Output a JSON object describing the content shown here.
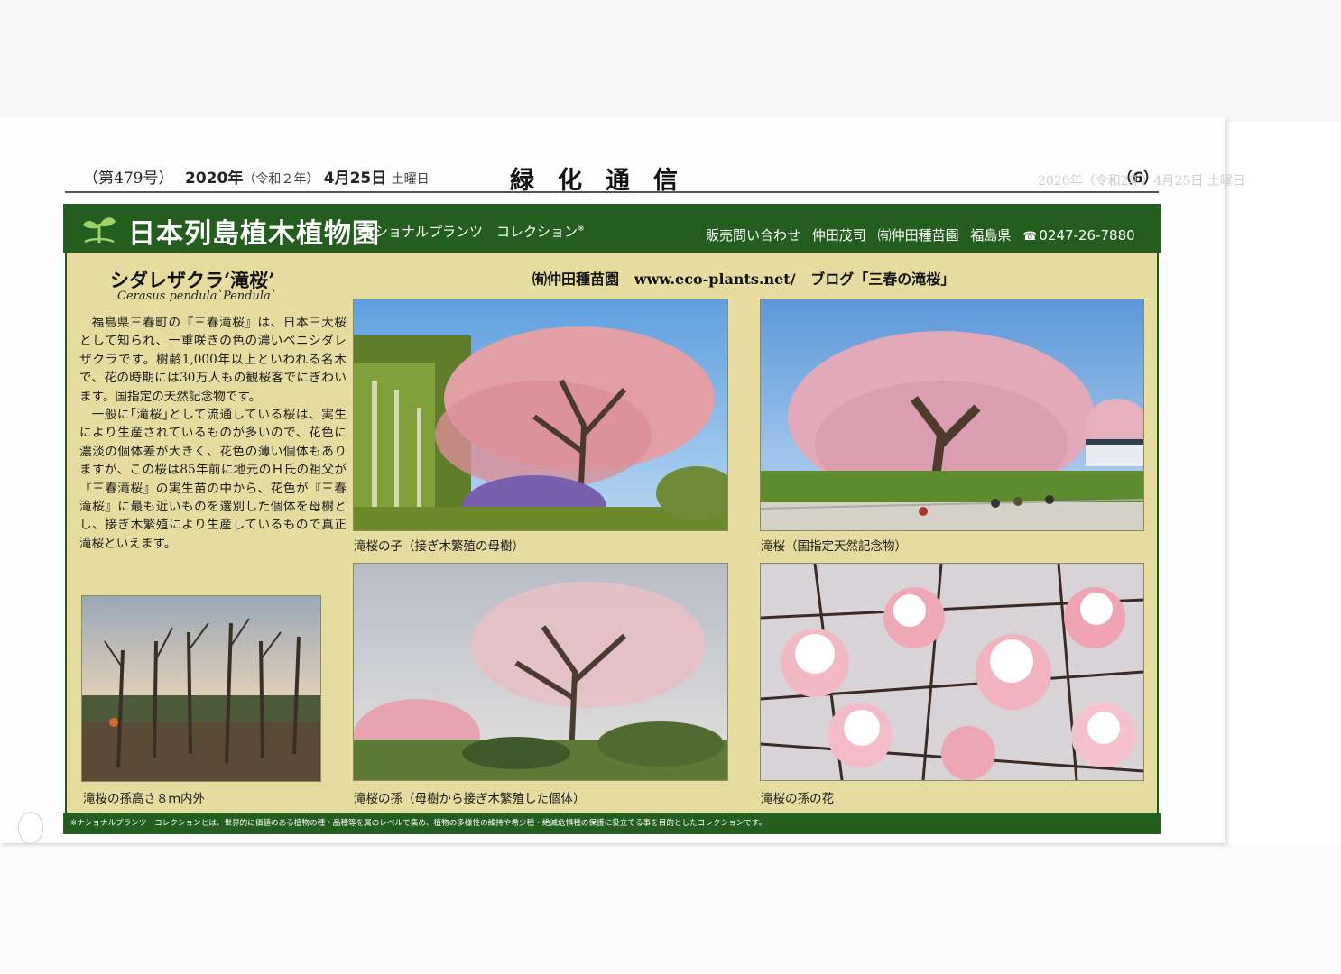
{
  "masthead": {
    "issue": "（第479号）",
    "year": "2020年",
    "era": "（令和２年）",
    "date": "4月25日",
    "weekday": "土曜日",
    "title": "緑化通信",
    "page": "（6）",
    "ghost": "2020年（令和2年）4月25日 土曜日"
  },
  "banner": {
    "title": "日本列島植木植物園",
    "subtitle": "ナショナルプランツ　コレクション",
    "subtitle_mark": "※",
    "contact_label": "販売問い合わせ",
    "contact_person": "仲田茂司",
    "company": "㈲仲田種苗園",
    "prefecture": "福島県",
    "phone": "0247-26-7880"
  },
  "article": {
    "title": "シダレザクラ‘滝桜’",
    "latin": "Cerasus pendula`Pendula`",
    "paragraph1": "福島県三春町の『三春滝桜』は、日本三大桜として知られ、一重咲きの色の濃いベニシダレザクラです。樹齢1,000年以上といわれる名木で、花の時期には30万人もの観桜客でにぎわいます。国指定の天然記念物です。",
    "paragraph2": "一般に｢滝桜｣として流通している桜は、実生により生産されているものが多いので、花色に濃淡の個体差が大きく、花色の薄い個体もありますが、この桜は85年前に地元のＨ氏の祖父が『三春滝桜』の実生苗の中から、花色が『三春滝桜』に最も近いものを選別した個体を母樹とし、接ぎ木繁殖により生産しているもので真正滝桜といえます。",
    "site_company": "㈲仲田種苗園",
    "site_url": "www.eco-plants.net/",
    "site_blog": "ブログ「三春の滝桜」"
  },
  "photos": {
    "p1_caption": "滝桜の子（接ぎ木繁殖の母樹）",
    "p2_caption": "滝桜（国指定天然記念物）",
    "p3_caption": "滝桜の孫高さ８ｍ内外",
    "p4_caption": "滝桜の孫（母樹から接ぎ木繁殖した個体）",
    "p5_caption": "滝桜の孫の花"
  },
  "footer": {
    "note": "※ナショナルプランツ　コレクションとは、世界的に価値のある植物の種・品種等を属のレベルで集め、植物の多様性の維持や希少種・絶滅危惧種の保護に役立てる事を目的としたコレクションです。"
  },
  "colors": {
    "banner_green": "#235e1e",
    "panel_beige": "#e6dca0"
  }
}
